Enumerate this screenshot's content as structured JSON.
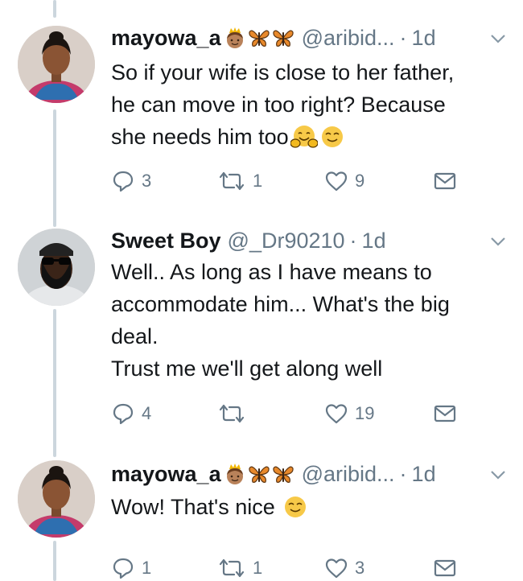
{
  "tweets": [
    {
      "name": "mayowa_a",
      "handle": "@aribid...",
      "dot": "·",
      "time": "1d",
      "text": "So if your wife is close to her father,\nhe can move in too right? Because\nshe needs him too",
      "emoji_after_text": [
        "hugging-face-emoji",
        "smiling-face-emoji"
      ],
      "name_emojis": [
        "princess-emoji",
        "butterfly-emoji",
        "butterfly-emoji"
      ],
      "replies": "3",
      "retweets": "1",
      "likes": "9"
    },
    {
      "name": "Sweet Boy",
      "handle": "@_Dr90210",
      "dot": "·",
      "time": "1d",
      "text": "Well..  As long as I have means to\naccommodate him... What's the big\ndeal.\nTrust me we'll get along well",
      "replies": "4",
      "retweets": "",
      "likes": "19"
    },
    {
      "name": "mayowa_a",
      "handle": "@aribid...",
      "dot": "·",
      "time": "1d",
      "text": "Wow!  That's nice",
      "emoji_after_text": [
        "smiling-face-emoji"
      ],
      "name_emojis": [
        "princess-emoji",
        "butterfly-emoji",
        "butterfly-emoji"
      ],
      "replies": "1",
      "retweets": "1",
      "likes": "3"
    }
  ],
  "colors": {
    "text": "#14171a",
    "secondary": "#657786",
    "thread_line": "#ccd6dd",
    "emoji_yellow": "#f7c948",
    "butterfly": "#e8892b"
  }
}
